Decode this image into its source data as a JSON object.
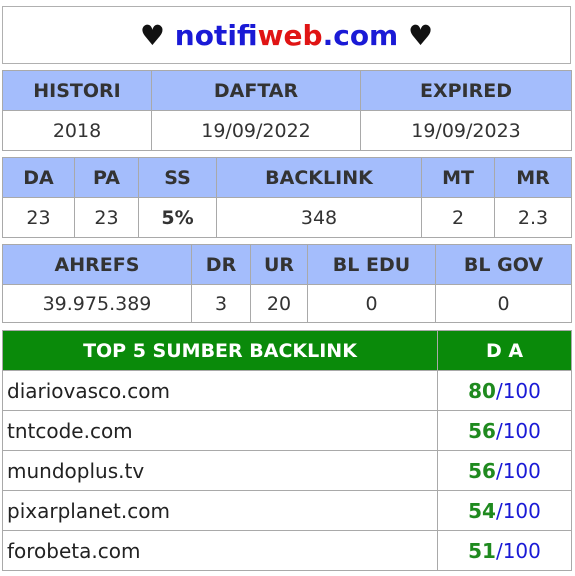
{
  "title": {
    "heart": "♥",
    "part1": "notifi",
    "part2": "web",
    "part3": ".com"
  },
  "history": {
    "headers": [
      "HISTORI",
      "DAFTAR",
      "EXPIRED"
    ],
    "values": [
      "2018",
      "19/09/2022",
      "19/09/2023"
    ]
  },
  "metrics": {
    "headers": [
      "DA",
      "PA",
      "SS",
      "BACKLINK",
      "MT",
      "MR"
    ],
    "values": [
      "23",
      "23",
      "5%",
      "348",
      "2",
      "2.3"
    ]
  },
  "ahrefs": {
    "headers": [
      "AHREFS",
      "DR",
      "UR",
      "BL EDU",
      "BL GOV"
    ],
    "values": [
      "39.975.389",
      "3",
      "20",
      "0",
      "0"
    ]
  },
  "top_backlinks": {
    "headers": [
      "TOP 5 SUMBER BACKLINK",
      "D A"
    ],
    "rows": [
      {
        "domain": "diariovasco.com",
        "da": "80",
        "max": "/100"
      },
      {
        "domain": "tntcode.com",
        "da": "56",
        "max": "/100"
      },
      {
        "domain": "mundoplus.tv",
        "da": "56",
        "max": "/100"
      },
      {
        "domain": "pixarplanet.com",
        "da": "54",
        "max": "/100"
      },
      {
        "domain": "forobeta.com",
        "da": "51",
        "max": "/100"
      }
    ]
  },
  "colors": {
    "header_blue": "#a4bdfc",
    "header_green": "#0a8a0a",
    "accent_blue": "#1a1ad6",
    "accent_red": "#e01414",
    "accent_green": "#1f8a1f"
  }
}
